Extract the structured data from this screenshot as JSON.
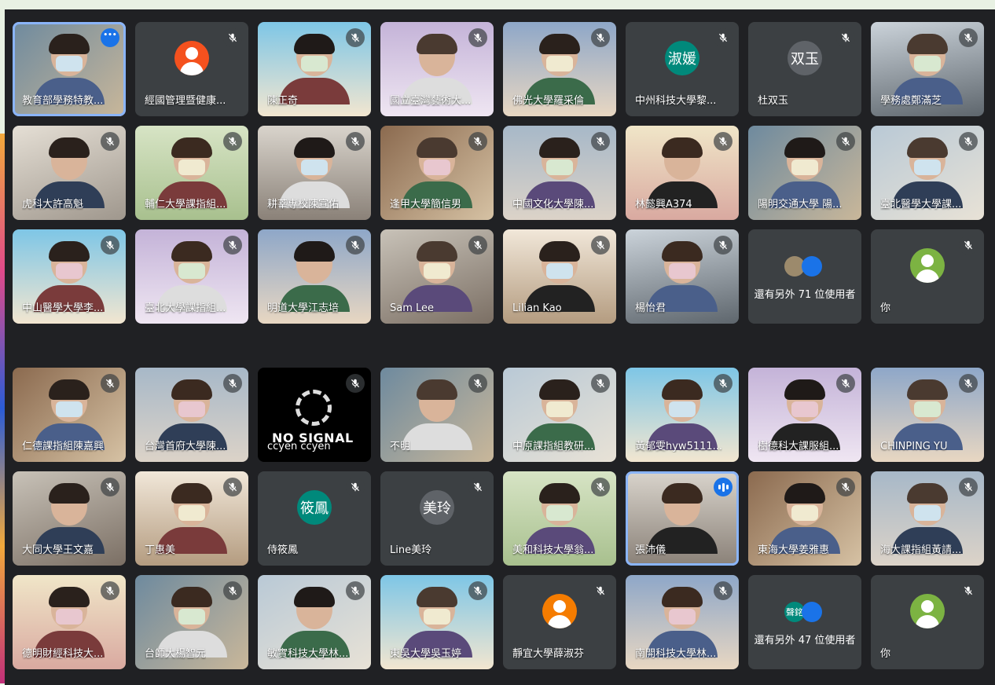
{
  "colors": {
    "background": "#202124",
    "tile": "#3c4043",
    "accent": "#8ab4f8",
    "brand_blue": "#1a73e8"
  },
  "icons": {
    "muted": "mic-off-icon",
    "more": "more-options-icon",
    "speaking": "audio-level-icon",
    "avatar": "person-avatar-icon"
  },
  "grid1": [
    {
      "name": "教育部學務特教...",
      "kind": "video",
      "menu": true
    },
    {
      "name": "經國管理暨健康...",
      "kind": "avatar",
      "avatar_color": "#f4511e"
    },
    {
      "name": "陳正奇",
      "kind": "video"
    },
    {
      "name": "國立臺灣藝術大...",
      "kind": "video"
    },
    {
      "name": "佛光大學羅采倫",
      "kind": "video"
    },
    {
      "name": "中州科技大學黎...",
      "kind": "initials",
      "initials": "淑媛",
      "avatar_color": "#00897b"
    },
    {
      "name": "杜双玉",
      "kind": "initials",
      "initials": "双玉",
      "avatar_color": "#5f6368"
    },
    {
      "name": "學務處鄭滿芝",
      "kind": "video"
    },
    {
      "name": "虎科大許高魁",
      "kind": "video"
    },
    {
      "name": "輔仁大學課指組...",
      "kind": "video"
    },
    {
      "name": "耕莘專校陳宣佑",
      "kind": "video"
    },
    {
      "name": "逢甲大學簡信男",
      "kind": "video"
    },
    {
      "name": "中國文化大學陳...",
      "kind": "video"
    },
    {
      "name": "林懿興A374",
      "kind": "video"
    },
    {
      "name": "陽明交通大學 陽...",
      "kind": "video"
    },
    {
      "name": "臺北醫學大學課...",
      "kind": "video"
    },
    {
      "name": "中山醫學大學李...",
      "kind": "video"
    },
    {
      "name": "臺北大學課指組...",
      "kind": "video"
    },
    {
      "name": "明道大學江志培",
      "kind": "video"
    },
    {
      "name": "Sam Lee",
      "kind": "video"
    },
    {
      "name": "Lilian Kao",
      "kind": "video"
    },
    {
      "name": "楊怡君",
      "kind": "video"
    },
    {
      "kind": "more",
      "more_text": "還有另外 71 位使用者"
    },
    {
      "name": "你",
      "kind": "you"
    }
  ],
  "grid2": [
    {
      "name": "仁德課指組陳嘉興",
      "kind": "video"
    },
    {
      "name": "台灣首府大學陳...",
      "kind": "video"
    },
    {
      "name": "ccyen ccyen",
      "kind": "nosignal",
      "nosignal_text": "NO SIGNAL"
    },
    {
      "name": "不明",
      "kind": "video"
    },
    {
      "name": "中原課指組教研...",
      "kind": "video"
    },
    {
      "name": "黃郁雯hyw5111...",
      "kind": "video"
    },
    {
      "name": "樹德科大課服組...",
      "kind": "video"
    },
    {
      "name": "CHINPING YU",
      "kind": "video"
    },
    {
      "name": "大同大學王文嘉",
      "kind": "video"
    },
    {
      "name": "丁惠美",
      "kind": "video"
    },
    {
      "name": "侍筱鳳",
      "kind": "initials",
      "initials": "筱鳳",
      "avatar_color": "#00897b"
    },
    {
      "name": "Line美玲",
      "kind": "initials",
      "initials": "美玲",
      "avatar_color": "#5f6368"
    },
    {
      "name": "美和科技大學翁...",
      "kind": "video"
    },
    {
      "name": "張沛儀",
      "kind": "video",
      "speaking": true
    },
    {
      "name": "東海大學姜雅惠",
      "kind": "video"
    },
    {
      "name": "海大課指組黃請...",
      "kind": "video"
    },
    {
      "name": "德明財經科技大...",
      "kind": "video"
    },
    {
      "name": "台師大楊智元",
      "kind": "video"
    },
    {
      "name": "敏實科技大學林...",
      "kind": "video"
    },
    {
      "name": "東吳大學吳玉婷",
      "kind": "video"
    },
    {
      "name": "靜宜大學薛淑芬",
      "kind": "avatar",
      "avatar_color": "#f57c00"
    },
    {
      "name": "南開科技大學林...",
      "kind": "video"
    },
    {
      "kind": "more",
      "more_text": "還有另外 47 位使用者",
      "stack_label": "聲銘"
    },
    {
      "name": "你",
      "kind": "you"
    }
  ]
}
